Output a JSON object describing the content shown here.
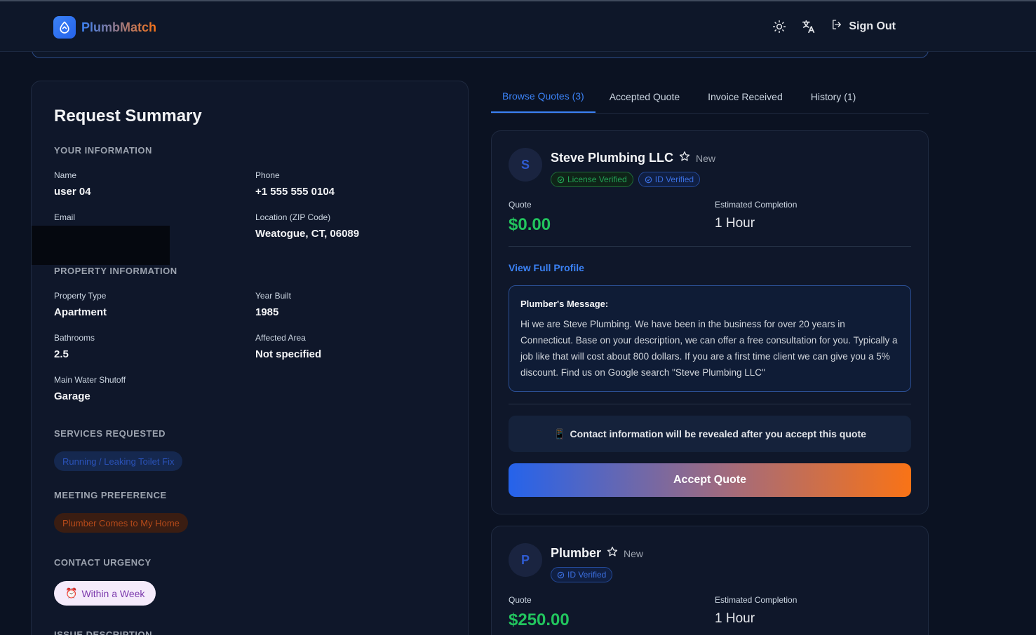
{
  "header": {
    "brand": "PlumbMatch",
    "signout_label": "Sign Out",
    "icons": [
      "theme-toggle-icon",
      "translate-icon",
      "sign-out-icon"
    ]
  },
  "summary": {
    "title": "Request Summary",
    "your_info": {
      "title": "YOUR INFORMATION",
      "name_label": "Name",
      "name_value": "user 04",
      "phone_label": "Phone",
      "phone_value": "+1 555 555 0104",
      "email_label": "Email",
      "location_label": "Location (ZIP Code)",
      "location_value": "Weatogue, CT, 06089"
    },
    "property": {
      "title": "PROPERTY INFORMATION",
      "type_label": "Property Type",
      "type_value": "Apartment",
      "year_label": "Year Built",
      "year_value": "1985",
      "baths_label": "Bathrooms",
      "baths_value": "2.5",
      "area_label": "Affected Area",
      "area_value": "Not specified",
      "shutoff_label": "Main Water Shutoff",
      "shutoff_value": "Garage"
    },
    "services": {
      "title": "SERVICES REQUESTED",
      "chip": "Running / Leaking Toilet Fix"
    },
    "meeting": {
      "title": "MEETING PREFERENCE",
      "chip": "Plumber Comes to My Home"
    },
    "urgency": {
      "title": "CONTACT URGENCY",
      "chip": "Within a Week",
      "emoji": "⏰"
    },
    "issue": {
      "title": "ISSUE DESCRIPTION"
    }
  },
  "tabs": [
    {
      "label": "Browse Quotes (3)",
      "active": true
    },
    {
      "label": "Accepted Quote",
      "active": false
    },
    {
      "label": "Invoice Received",
      "active": false
    },
    {
      "label": "History (1)",
      "active": false
    }
  ],
  "quotes": [
    {
      "initial": "S",
      "name": "Steve Plumbing LLC",
      "status": "New",
      "badges": [
        "License Verified",
        "ID Verified"
      ],
      "quote_label": "Quote",
      "quote_value": "$0.00",
      "eta_label": "Estimated Completion",
      "eta_value": "1 Hour",
      "profile_link": "View Full Profile",
      "message_title": "Plumber's Message:",
      "message": "Hi we are Steve Plumbing. We have been in the business for over 20 years in Connecticut. Base on your description, we can offer a free consultation for you. Typically a job like that will cost about 800 dollars. If you are a first time client we can give you a 5% discount. Find us on Google search \"Steve Plumbing LLC\"",
      "notice": "Contact information will be revealed after you accept this quote",
      "notice_emoji": "📱",
      "accept_label": "Accept Quote"
    },
    {
      "initial": "P",
      "name": "Plumber",
      "status": "New",
      "badges": [
        "ID Verified"
      ],
      "quote_label": "Quote",
      "quote_value": "$250.00",
      "eta_label": "Estimated Completion",
      "eta_value": "1 Hour"
    }
  ]
}
